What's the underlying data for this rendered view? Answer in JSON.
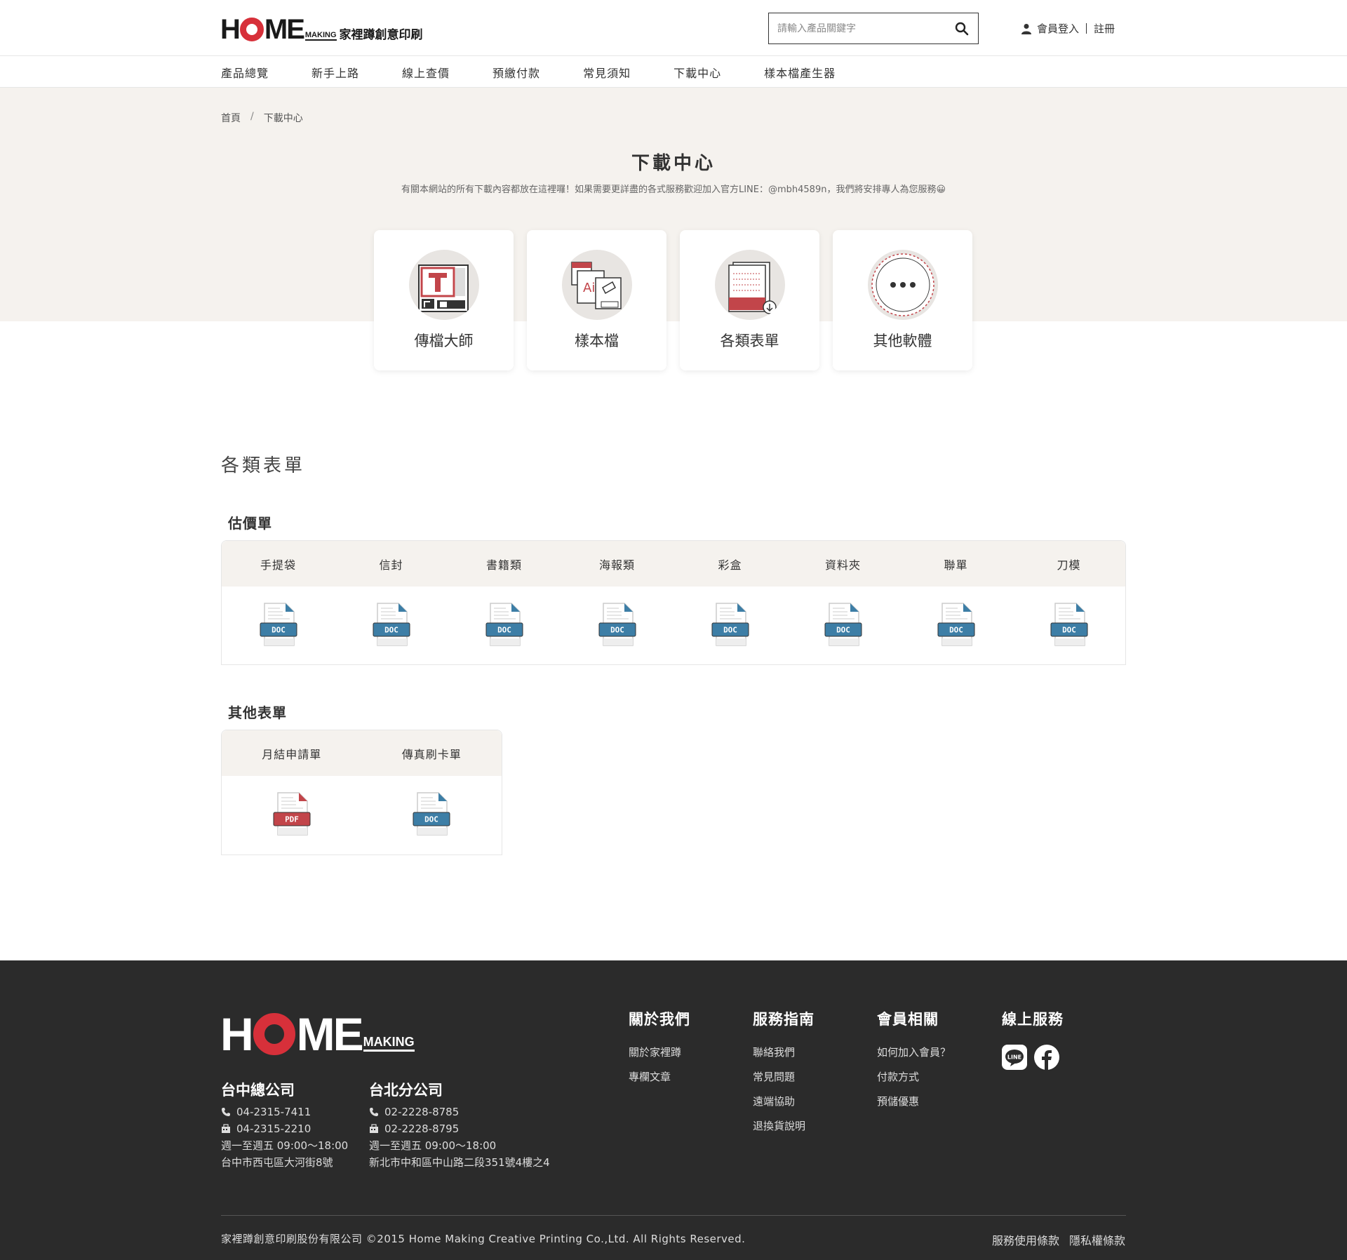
{
  "header": {
    "logo_brand": "HOME",
    "logo_sub": "MAKING",
    "logo_cn": "家裡蹲創意印刷",
    "search_placeholder": "請輸入產品關鍵字",
    "login": "會員登入",
    "register": "註冊"
  },
  "nav": {
    "items": [
      "產品總覽",
      "新手上路",
      "線上查價",
      "預繳付款",
      "常見須知",
      "下載中心",
      "樣本檔產生器"
    ]
  },
  "breadcrumb": {
    "home": "首頁",
    "separator": "/",
    "current": "下載中心"
  },
  "page": {
    "title": "下載中心",
    "description": "有關本網站的所有下載內容都放在這裡囉！如果需要更詳盡的各式服務歡迎加入官方LINE：@mbh4589n，我們將安排專人為您服務😀"
  },
  "cards": [
    {
      "label": "傳檔大師",
      "icon": "transfer-master-icon"
    },
    {
      "label": "樣本檔",
      "icon": "sample-file-icon"
    },
    {
      "label": "各類表單",
      "icon": "forms-icon"
    },
    {
      "label": "其他軟體",
      "icon": "other-software-icon"
    }
  ],
  "section": {
    "title": "各類表單",
    "quote_title": "估價單",
    "quote_forms": [
      {
        "label": "手提袋",
        "type": "DOC"
      },
      {
        "label": "信封",
        "type": "DOC"
      },
      {
        "label": "書籍類",
        "type": "DOC"
      },
      {
        "label": "海報類",
        "type": "DOC"
      },
      {
        "label": "彩盒",
        "type": "DOC"
      },
      {
        "label": "資料夾",
        "type": "DOC"
      },
      {
        "label": "聯單",
        "type": "DOC"
      },
      {
        "label": "刀模",
        "type": "DOC"
      }
    ],
    "other_title": "其他表單",
    "other_forms": [
      {
        "label": "月結申請單",
        "type": "PDF"
      },
      {
        "label": "傳真刷卡單",
        "type": "DOC"
      }
    ]
  },
  "footer": {
    "logo_brand": "HOME",
    "logo_sub": "MAKING",
    "taichung": {
      "title": "台中總公司",
      "phone": "04-2315-7411",
      "fax": "04-2315-2210",
      "hours": "週一至週五 09:00～18:00",
      "address": "台中市西屯區大河街8號"
    },
    "taipei": {
      "title": "台北分公司",
      "phone": "02-2228-8785",
      "fax": "02-2228-8795",
      "hours": "週一至週五 09:00～18:00",
      "address": "新北市中和區中山路二段351號4樓之4"
    },
    "about": {
      "title": "關於我們",
      "links": [
        "關於家裡蹲",
        "專欄文章"
      ]
    },
    "guide": {
      "title": "服務指南",
      "links": [
        "聯絡我們",
        "常見問題",
        "遠端協助",
        "退換貨說明"
      ]
    },
    "member": {
      "title": "會員相關",
      "links": [
        "如何加入會員？",
        "付款方式",
        "預儲優惠"
      ]
    },
    "online": {
      "title": "線上服務",
      "icons": [
        "line-icon",
        "facebook-icon"
      ]
    },
    "copyright": "家裡蹲創意印刷股份有限公司 ©2015 Home Making Creative Printing Co.,Ltd. All Rights Reserved.",
    "terms": "服務使用條款",
    "privacy": "隱私權條款"
  },
  "colors": {
    "accent_red": "#d7303a",
    "doc_blue": "#3d7ea6",
    "pdf_red": "#c2454a",
    "beige": "#f5f2ee",
    "footer_bg": "#2b2b2b"
  }
}
